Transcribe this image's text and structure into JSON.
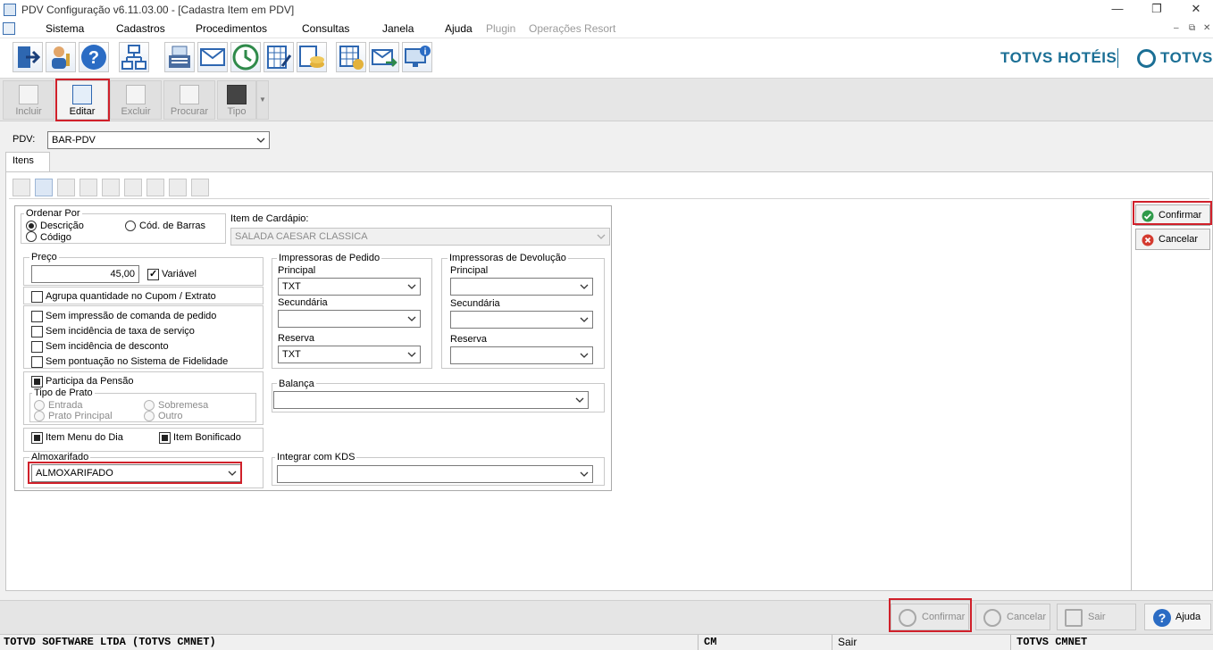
{
  "window": {
    "title": "PDV Configuração v6.11.03.00 - [Cadastra Item em PDV]",
    "minimize": "—",
    "restore": "❐",
    "close": "✕"
  },
  "menu": {
    "items": [
      "Sistema",
      "Cadastros",
      "Procedimentos",
      "Consultas",
      "Janela",
      "Ajuda"
    ],
    "disabled_items": [
      "Plugin",
      "Operações Resort"
    ],
    "mdi_controls": [
      "–",
      "⧉",
      "✕"
    ]
  },
  "brand": {
    "left": "TOTVS HOTÉIS",
    "right": "TOTVS",
    "color": "#1b6f95"
  },
  "toolbar2": {
    "incluir": "Incluir",
    "editar": "Editar",
    "excluir": "Excluir",
    "procurar": "Procurar",
    "tipo": "Tipo"
  },
  "pdv": {
    "label": "PDV:",
    "value": "BAR-PDV"
  },
  "tab": {
    "label": "Itens"
  },
  "form": {
    "ordenar": {
      "title": "Ordenar Por",
      "descricao": "Descrição",
      "codigo": "Código",
      "cod_barras": "Cód. de Barras",
      "selected": "Descrição"
    },
    "item_cardapio": {
      "label": "Item de Cardápio:",
      "value": "SALADA CAESAR CLASSICA"
    },
    "preco": {
      "title": "Preço",
      "value": "45,00",
      "variavel": "Variável",
      "variavel_checked": true
    },
    "agrupa": "Agrupa quantidade no Cupom / Extrato",
    "checks": {
      "sem_impressao": "Sem impressão de comanda de pedido",
      "sem_taxa": "Sem incidência de taxa de serviço",
      "sem_desconto": "Sem incidência de desconto",
      "sem_pontuacao": "Sem pontuação no Sistema de Fidelidade"
    },
    "pensao": {
      "participa": "Participa da Pensão",
      "tipo_prato": "Tipo de Prato",
      "entrada": "Entrada",
      "prato_principal": "Prato Principal",
      "sobremesa": "Sobremesa",
      "outro": "Outro"
    },
    "item_menu_dia": "Item Menu do Dia",
    "item_bonificado": "Item Bonificado",
    "almoxarifado": {
      "label": "Almoxarifado",
      "value": "ALMOXARIFADO"
    },
    "impressoras_pedido": {
      "title": "Impressoras de Pedido",
      "principal_label": "Principal",
      "principal_value": "TXT",
      "secundaria_label": "Secundária",
      "secundaria_value": "",
      "reserva_label": "Reserva",
      "reserva_value": "TXT"
    },
    "impressoras_devolucao": {
      "title": "Impressoras de Devolução",
      "principal_label": "Principal",
      "principal_value": "",
      "secundaria_label": "Secundária",
      "secundaria_value": "",
      "reserva_label": "Reserva",
      "reserva_value": ""
    },
    "balanca": {
      "label": "Balança",
      "value": ""
    },
    "kds": {
      "label": "Integrar com KDS",
      "value": ""
    }
  },
  "side": {
    "confirmar": "Confirmar",
    "cancelar": "Cancelar"
  },
  "bottom": {
    "confirmar": "Confirmar",
    "cancelar": "Cancelar",
    "sair": "Sair",
    "ajuda": "Ajuda"
  },
  "status": {
    "company": "TOTVD SOFTWARE LTDA (TOTVS CMNET)",
    "user": "CM",
    "action": "Sair",
    "system": "TOTVS CMNET"
  }
}
